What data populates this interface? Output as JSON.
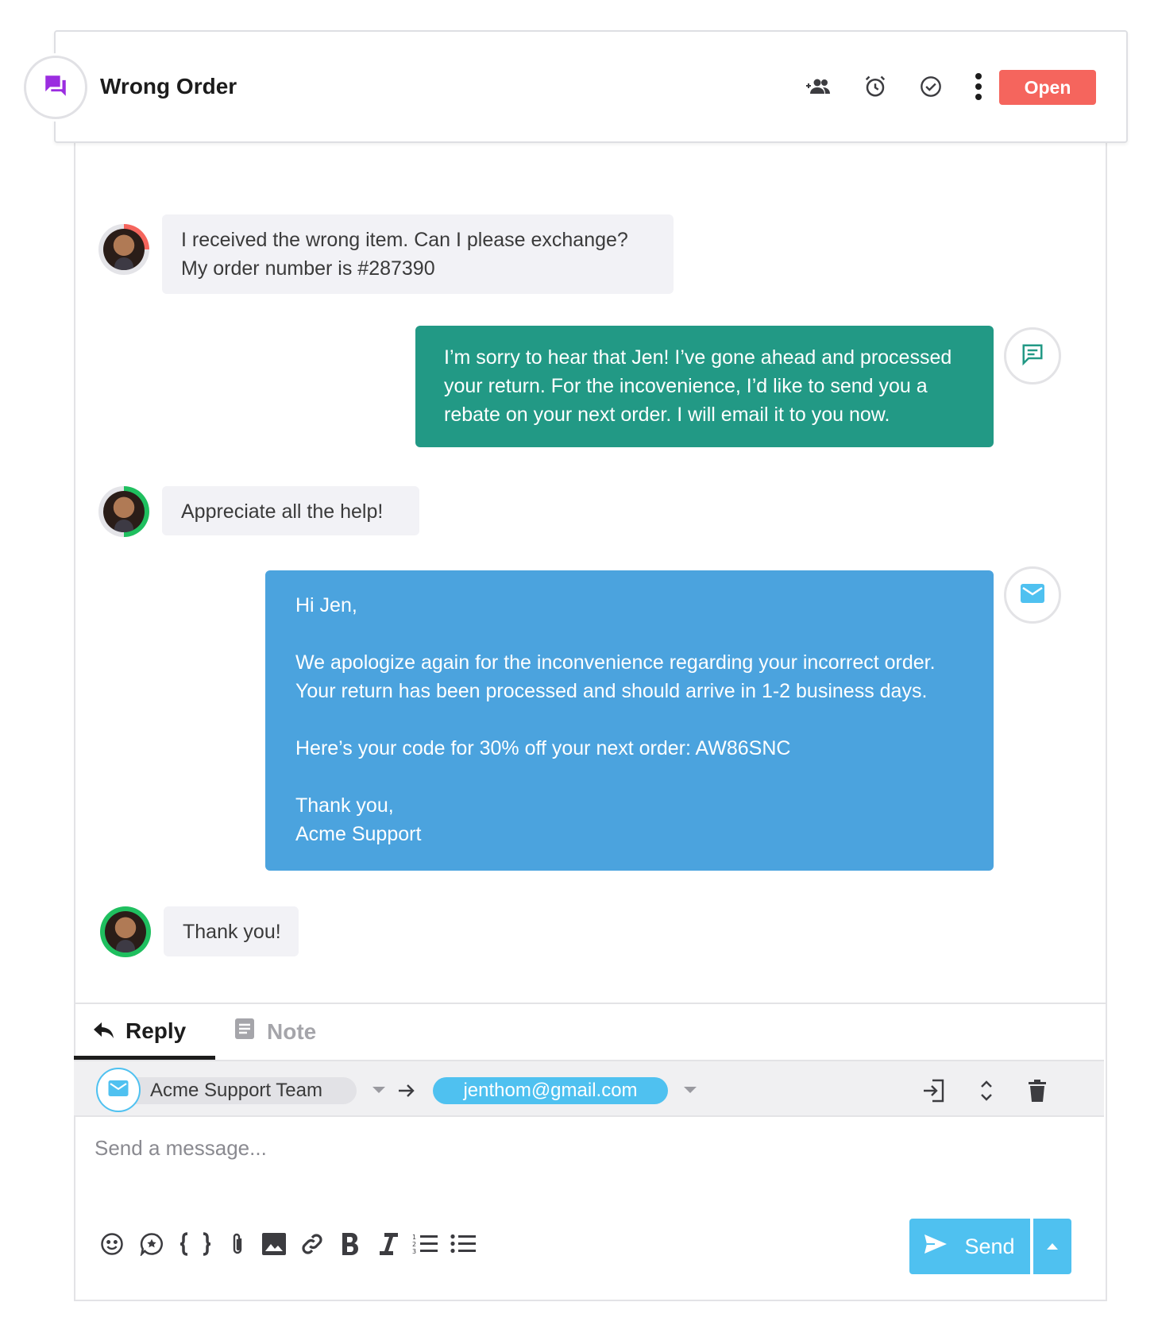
{
  "header": {
    "title": "Wrong Order",
    "status_label": "Open",
    "icons": [
      "chat-icon",
      "add-people-icon",
      "alarm-icon",
      "check-circle-icon",
      "more-vert-icon"
    ]
  },
  "messages": [
    {
      "type": "customer",
      "lines": [
        "I received the wrong item. Can I please exchange?",
        "My order number is #287390"
      ]
    },
    {
      "type": "agent-chat",
      "lines": [
        "I’m sorry to hear that Jen! I’ve gone ahead and processed",
        "your return. For the incovenience, I’d like to send you a",
        "rebate on your next order. I will email it to you now."
      ]
    },
    {
      "type": "customer",
      "lines": [
        "Appreciate all the help!"
      ]
    },
    {
      "type": "agent-email",
      "lines": [
        "Hi Jen,",
        "",
        "We apologize again for the inconvenience regarding your incorrect order.",
        "Your return has been processed and should arrive in 1-2 business days.",
        "",
        "Here’s your code for 30% off your next order: AW86SNC",
        "",
        "Thank you,",
        "Acme Support"
      ]
    },
    {
      "type": "customer",
      "lines": [
        "Thank you!"
      ]
    }
  ],
  "reply": {
    "tabs": [
      {
        "label": "Reply",
        "active": true
      },
      {
        "label": "Note",
        "active": false
      }
    ],
    "from": "Acme Support Team",
    "to": "jenthom@gmail.com",
    "placeholder": "Send a message...",
    "send_label": "Send",
    "toolbar": [
      "emoji-icon",
      "sticker-icon",
      "template-braces-icon",
      "attachment-icon",
      "image-icon",
      "link-icon",
      "bold-icon",
      "italic-icon",
      "numbered-list-icon",
      "bullet-list-icon"
    ]
  },
  "colors": {
    "open": "#f5655d",
    "chat_bubble": "#229985",
    "email_bubble": "#4ba3de",
    "accent": "#4fc1f0",
    "brand_purple": "#9b2de0"
  }
}
